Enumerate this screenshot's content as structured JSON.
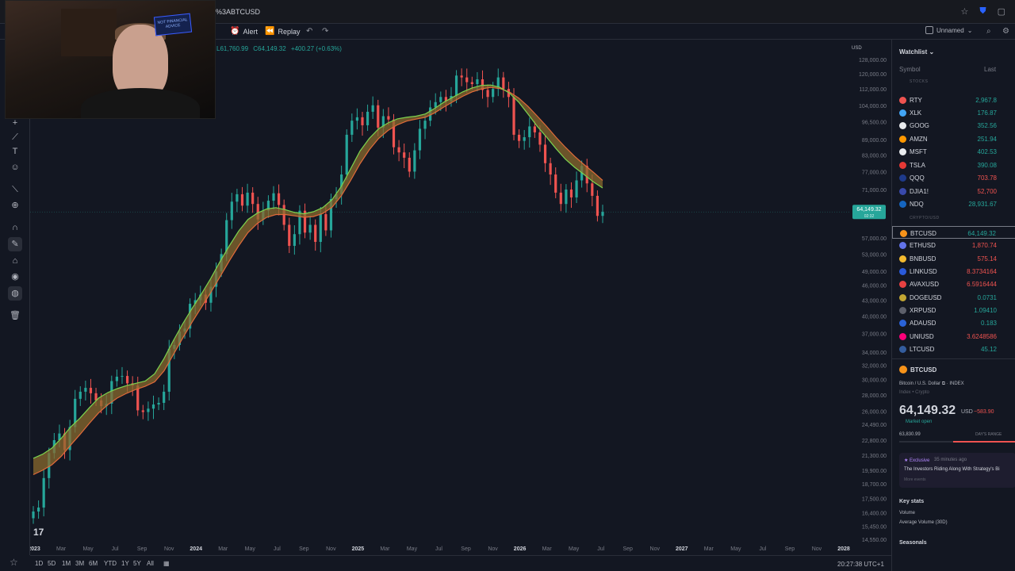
{
  "browser": {
    "url": "%3ABTCUSD"
  },
  "toolbar": {
    "alert_label": "Alert",
    "replay_label": "Replay",
    "layout_name": "Unnamed"
  },
  "ohlc": {
    "low": "L61,760.99",
    "close": "C64,149.32",
    "change": "+400.27 (+0.63%)"
  },
  "currency_label": "USD",
  "price_axis": {
    "ticks": [
      "128,000.00",
      "120,000.00",
      "112,000.00",
      "104,000.00",
      "96,500.00",
      "89,000.00",
      "83,000.00",
      "77,000.00",
      "71,000.00",
      "57,000.00",
      "53,000.00",
      "49,000.00",
      "46,000.00",
      "43,000.00",
      "40,000.00",
      "37,000.00",
      "34,000.00",
      "32,000.00",
      "30,000.00",
      "28,000.00",
      "26,000.00",
      "24,490.00",
      "22,800.00",
      "21,300.00",
      "19,900.00",
      "18,700.00",
      "17,500.00",
      "16,400.00",
      "15,450.00",
      "14,550.00"
    ],
    "current_price": "64,149.32",
    "current_sub": "02:32"
  },
  "time_axis": [
    "2023",
    "Mar",
    "May",
    "Jul",
    "Sep",
    "Nov",
    "2024",
    "Mar",
    "May",
    "Jul",
    "Sep",
    "Nov",
    "2025",
    "Mar",
    "May",
    "Jul",
    "Sep",
    "Nov",
    "2026",
    "Mar",
    "May",
    "Jul",
    "Sep",
    "Nov",
    "2027",
    "Mar",
    "May",
    "Jul",
    "Sep",
    "Nov",
    "2028"
  ],
  "ranges": [
    "1D",
    "5D",
    "1M",
    "3M",
    "6M",
    "YTD",
    "1Y",
    "5Y",
    "All"
  ],
  "clock": "20:27:38 UTC+1",
  "colors": {
    "up": "#26a69a",
    "down": "#ef5350",
    "ema_fast": "#7bd44f",
    "ema_slow": "#e06a3a",
    "ribbon": "#8a6a2e",
    "bg": "#131722"
  },
  "chart_data": {
    "type": "candlestick",
    "symbol": "BTCUSD",
    "scale": "log",
    "ylim": [
      14550,
      128000
    ],
    "x_start": "2023",
    "x_end": "2028",
    "closes": [
      16500,
      16800,
      19200,
      21500,
      22800,
      23500,
      21800,
      24200,
      27500,
      28400,
      28900,
      28200,
      27300,
      26600,
      26900,
      29800,
      30400,
      30500,
      29500,
      29200,
      26100,
      25900,
      26300,
      26800,
      27000,
      28400,
      34500,
      35100,
      37300,
      37800,
      42300,
      43000,
      44100,
      42500,
      45700,
      49000,
      53000,
      61800,
      67200,
      69500,
      66000,
      70000,
      66500,
      62000,
      64500,
      67500,
      69800,
      66200,
      60500,
      55000,
      58000,
      64500,
      58400,
      60500,
      56000,
      63500,
      59000,
      68000,
      69500,
      76000,
      91000,
      97000,
      98500,
      95000,
      101000,
      104000,
      94000,
      99000,
      97500,
      86000,
      84000,
      82000,
      77000,
      84800,
      93500,
      97000,
      103000,
      105500,
      108000,
      106000,
      108500,
      119000,
      118000,
      115500,
      114500,
      117000,
      111500,
      108000,
      112000,
      118000,
      112000,
      108000,
      91000,
      88500,
      90000,
      94500,
      92000,
      87000,
      80000,
      76000,
      70000,
      66500,
      71000,
      68500,
      74000,
      79000,
      73000,
      69000,
      63000,
      64149
    ],
    "ema_fast": [
      21000,
      21400,
      22000,
      23000,
      24200,
      25200,
      26400,
      27600,
      28300,
      28800,
      29200,
      29500,
      29800,
      30800,
      33000,
      35800,
      38600,
      41400,
      44200,
      47400,
      51200,
      55000,
      58800,
      62000,
      63800,
      65000,
      65400,
      64800,
      64000,
      63600,
      64200,
      65400,
      67800,
      72000,
      78000,
      84500,
      89500,
      93500,
      96000,
      97800,
      98500,
      99000,
      100000,
      102500,
      105500,
      108000,
      110500,
      112500,
      113800,
      114000,
      112800,
      110000,
      105500,
      100000,
      94500,
      90000,
      85500,
      81500,
      78500,
      76000,
      73500,
      71500
    ],
    "ema_slow": [
      19500,
      19900,
      20400,
      21200,
      22300,
      23400,
      24600,
      25800,
      26800,
      27600,
      28200,
      28700,
      29100,
      29700,
      31200,
      33600,
      36200,
      38900,
      41600,
      44500,
      47800,
      51400,
      55000,
      58400,
      60900,
      62600,
      63400,
      63400,
      63000,
      62600,
      62800,
      63700,
      65500,
      69000,
      74000,
      79800,
      85000,
      89500,
      92800,
      95200,
      96800,
      97700,
      98500,
      100500,
      103200,
      105800,
      108300,
      110500,
      112000,
      112800,
      112200,
      110500,
      107500,
      103500,
      99000,
      94500,
      90000,
      86000,
      82500,
      79500,
      76800,
      74000
    ]
  },
  "watchlist": {
    "title": "Watchlist",
    "col_symbol": "Symbol",
    "col_last": "Last",
    "sections": {
      "stocks": "STOCKS",
      "crypto": "CRYPTO/USD"
    },
    "items": [
      {
        "sym": "RTY",
        "last": "2,967.8",
        "color": "#ef5350",
        "down": false
      },
      {
        "sym": "XLK",
        "last": "176.87",
        "color": "#42a5f5",
        "down": false
      },
      {
        "sym": "GOOG",
        "last": "352.56",
        "color": "#e8eaed",
        "down": false
      },
      {
        "sym": "AMZN",
        "last": "251.94",
        "color": "#ff9800",
        "down": false
      },
      {
        "sym": "MSFT",
        "last": "402.53",
        "color": "#e8eaed",
        "down": false
      },
      {
        "sym": "TSLA",
        "last": "390.08",
        "color": "#e53935",
        "down": false
      },
      {
        "sym": "QQQ",
        "last": "703.78",
        "color": "#1e3a8a",
        "down": true
      },
      {
        "sym": "DJIA1!",
        "last": "52,700",
        "color": "#3949ab",
        "down": true
      },
      {
        "sym": "NDQ",
        "last": "28,931.67",
        "color": "#1565c0",
        "down": false
      },
      {
        "sym": "BTCUSD",
        "last": "64,149.32",
        "color": "#f7931a",
        "down": false
      },
      {
        "sym": "ETHUSD",
        "last": "1,870.74",
        "color": "#6273ea",
        "down": true
      },
      {
        "sym": "BNBUSD",
        "last": "575.14",
        "color": "#f3ba2f",
        "down": true
      },
      {
        "sym": "LINKUSD",
        "last": "8.3734164",
        "color": "#2a5ada",
        "down": true
      },
      {
        "sym": "AVAXUSD",
        "last": "6.5916444",
        "color": "#e84142",
        "down": true
      },
      {
        "sym": "DOGEUSD",
        "last": "0.0731",
        "color": "#c2a633",
        "down": false
      },
      {
        "sym": "XRPUSD",
        "last": "1.09410",
        "color": "#5d606b",
        "down": false
      },
      {
        "sym": "ADAUSD",
        "last": "0.183",
        "color": "#2a63d8",
        "down": false
      },
      {
        "sym": "UNIUSD",
        "last": "3.6248586",
        "color": "#ff007a",
        "down": true
      },
      {
        "sym": "LTCUSD",
        "last": "45.12",
        "color": "#345d9d",
        "down": false
      }
    ]
  },
  "detail": {
    "symbol": "BTCUSD",
    "name": "Bitcoin / U.S. Dollar",
    "exchange": "INDEX",
    "category": "Index • Crypto",
    "price": "64,149.32",
    "currency": "USD",
    "change": "−583.90",
    "status": "Market open",
    "day_low": "63,830.99",
    "day_range_label": "DAY'S RANGE",
    "news_tag": "Exclusive",
    "news_time": "35 minutes ago",
    "news_headline": "The Investors Riding Along With Strategy's Bi",
    "news_more": "More events",
    "key_stats": "Key stats",
    "volume_label": "Volume",
    "avg_volume_label": "Average Volume (30D)",
    "seasonals": "Seasonals"
  },
  "webcam": {
    "sign_text": "NOT FINANCIAL ADVICE"
  }
}
